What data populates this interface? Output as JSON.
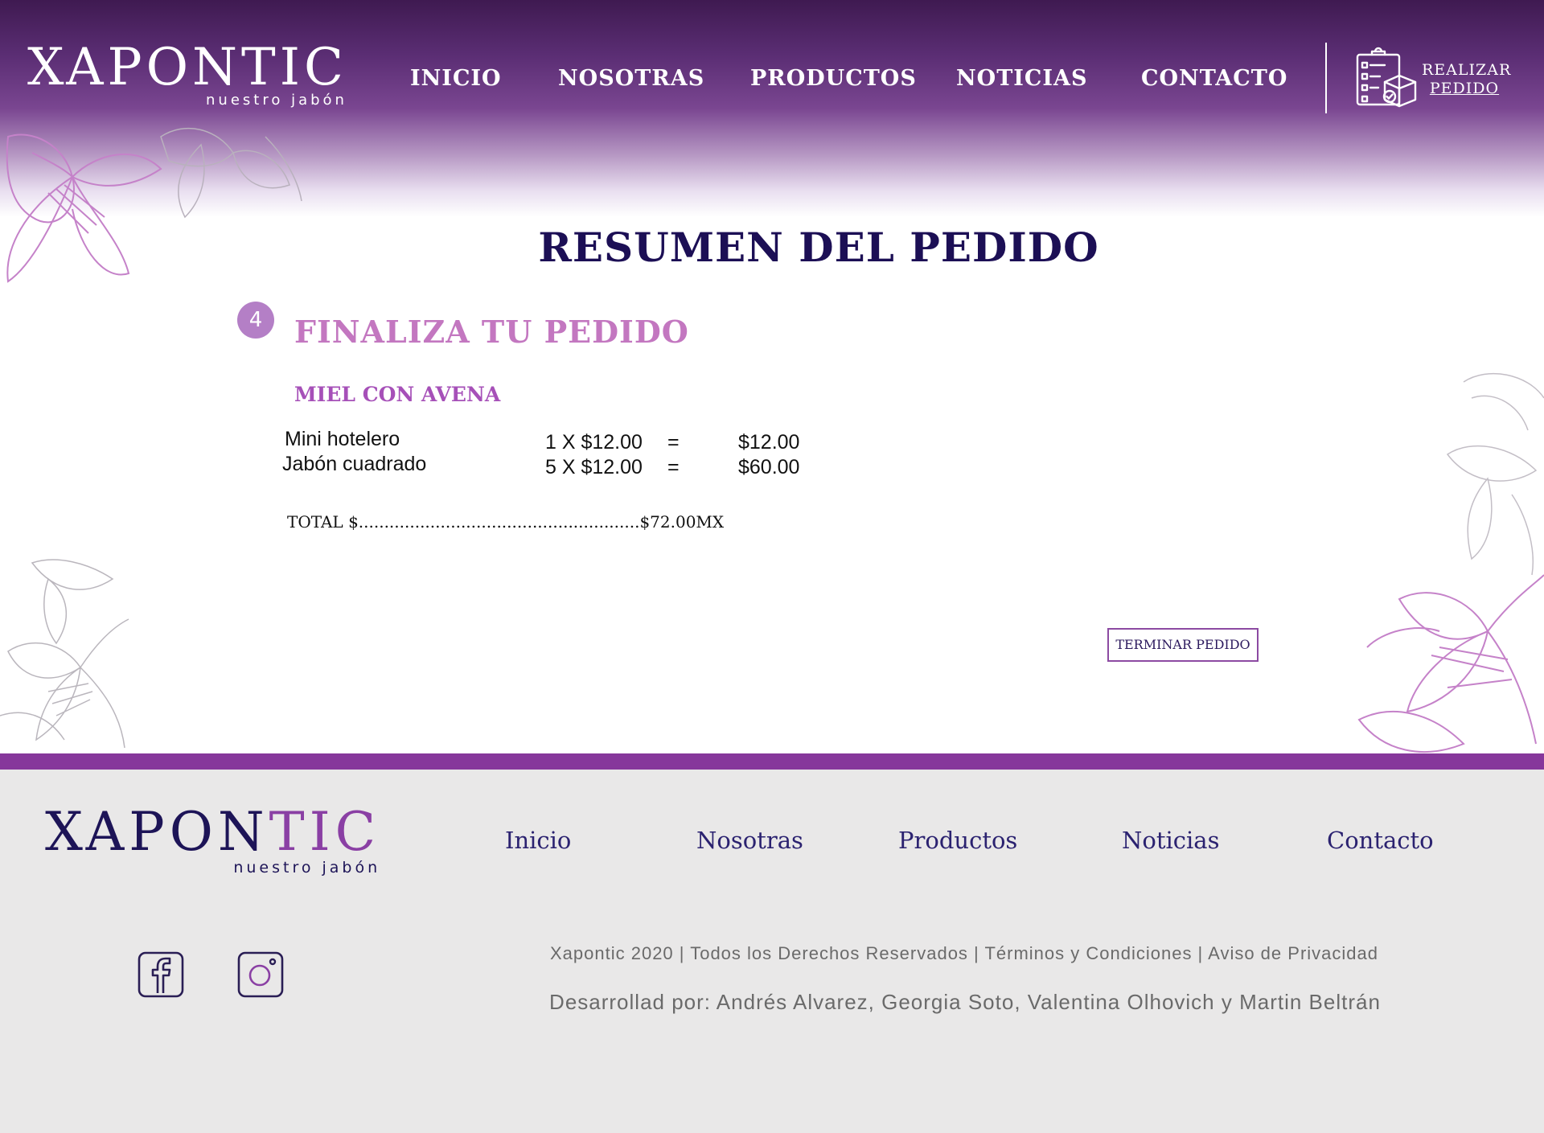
{
  "header": {
    "logo_main": "XAPONTIC",
    "logo_sub": "nuestro jabón",
    "nav": [
      {
        "label": "INICIO"
      },
      {
        "label": "NOSOTRAS"
      },
      {
        "label": "PRODUCTOS"
      },
      {
        "label": "NOTICIAS"
      },
      {
        "label": "CONTACTO"
      }
    ],
    "order_button": {
      "line1": "REALIZAR",
      "line2": "PEDIDO",
      "icon": "order-clipboard-icon"
    }
  },
  "main": {
    "title": "RESUMEN DEL PEDIDO",
    "step_number": "4",
    "step_title": "FINALIZA TU PEDIDO",
    "product_name": "MIEL CON AVENA",
    "items": [
      {
        "name": "Mini hotelero",
        "qty_price": "1 X $12.00",
        "equals": "=",
        "total": "$12.00"
      },
      {
        "name": "Jabón cuadrado",
        "qty_price": "5 X $12.00",
        "equals": "=",
        "total": "$60.00"
      }
    ],
    "total_line": "TOTAL $.......................................................$72.00MX",
    "finish_button": "TERMINAR PEDIDO"
  },
  "footer": {
    "logo_main_a": "XAPON",
    "logo_main_b": "TIC",
    "logo_sub": "nuestro jabón",
    "nav": [
      {
        "label": "Inicio"
      },
      {
        "label": "Nosotras"
      },
      {
        "label": "Productos"
      },
      {
        "label": "Noticias"
      },
      {
        "label": "Contacto"
      }
    ],
    "social": [
      {
        "icon": "facebook-icon"
      },
      {
        "icon": "instagram-icon"
      }
    ],
    "copyright": "Xapontic 2020 | Todos los Derechos Reservados | Términos y Condiciones | Aviso de Privacidad",
    "credits": "Desarrollad por: Andrés Alvarez, Georgia Soto, Valentina Olhovich y Martin Beltrán"
  },
  "colors": {
    "header_purple": "#3f1a51",
    "title_navy": "#1c0f55",
    "accent_pink": "#c377c0",
    "footer_bar": "#86379b",
    "footer_bg": "#e9e8e8"
  }
}
